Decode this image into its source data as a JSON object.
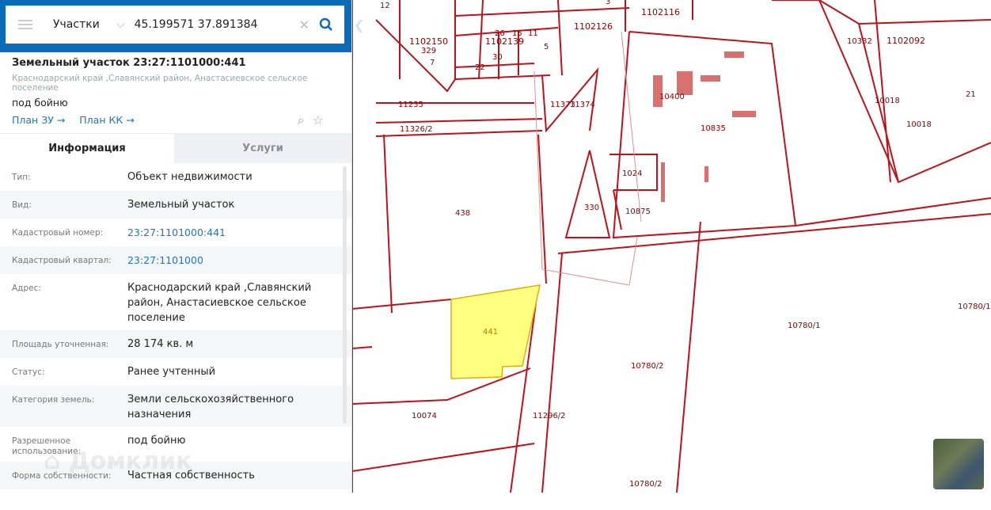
{
  "search": {
    "mode": "Участки",
    "query": "45.199571 37.891384"
  },
  "card": {
    "title": "Земельный участок 23:27:1101000:441",
    "address": "Краснодарский край ,Славянский район, Анастасиевское сельское поселение",
    "use": "под бойню",
    "links": [
      "План ЗУ →",
      "План КК →"
    ]
  },
  "tabs": [
    {
      "label": "Информация",
      "active": true
    },
    {
      "label": "Услуги",
      "active": false
    }
  ],
  "rows": [
    {
      "k": "Тип:",
      "v": "Объект недвижимости"
    },
    {
      "k": "Вид:",
      "v": "Земельный участок"
    },
    {
      "k": "Кадастровый номер:",
      "v": "23:27:1101000:441",
      "link": true
    },
    {
      "k": "Кадастровый квартал:",
      "v": "23:27:1101000",
      "link": true
    },
    {
      "k": "Адрес:",
      "v": "Краснодарский край ,Славянский район, Анастасиевское сельское поселение"
    },
    {
      "k": "Площадь уточненная:",
      "v": "28 174 кв. м"
    },
    {
      "k": "Статус:",
      "v": "Ранее учтенный"
    },
    {
      "k": "Категория земель:",
      "v": "Земли сельскохозяйственного назначения"
    },
    {
      "k": "Разрешенное использование:",
      "v": "под бойню"
    },
    {
      "k": "Форма собственности:",
      "v": "Частная собственность"
    }
  ],
  "watermark": "Домклик",
  "colors": {
    "brand": "#0a6cb8",
    "parcel_line": "#c0101a",
    "selected_fill": "#ffff80"
  },
  "map_labels": [
    "12",
    "1102150",
    "1102139",
    "1102126",
    "1102116",
    "1102092",
    "329",
    "7",
    "26",
    "15",
    "11",
    "5",
    "22",
    "30",
    "11235",
    "11326/2",
    "11373",
    "11374",
    "10400",
    "10835",
    "10018",
    "10332",
    "21",
    "438",
    "330",
    "1024",
    "10875",
    "441",
    "10780/1",
    "10780/2",
    "10780/1",
    "10074",
    "11296/2",
    "10780/2",
    "10018",
    "3"
  ]
}
